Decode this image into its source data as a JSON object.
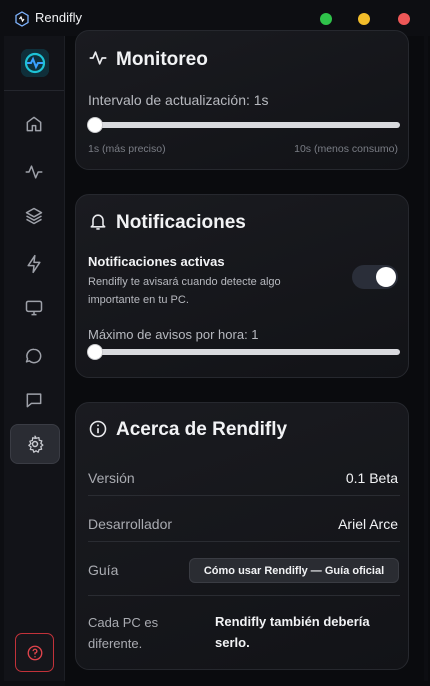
{
  "window": {
    "title": "Rendifly",
    "controls": [
      "green-dot",
      "yellow-dot",
      "red-dot"
    ],
    "colors": {
      "green": "#2fc24a",
      "yellow": "#f2bd2a",
      "red": "#ee5757"
    }
  },
  "sidebar": {
    "items": [
      {
        "name": "home",
        "icon": "home-icon"
      },
      {
        "name": "activity",
        "icon": "activity-icon"
      },
      {
        "name": "layers",
        "icon": "layers-icon"
      },
      {
        "name": "boost",
        "icon": "bolt-icon"
      },
      {
        "name": "monitor",
        "icon": "monitor-icon"
      },
      {
        "name": "chat",
        "icon": "chat-bubble-icon"
      },
      {
        "name": "messages",
        "icon": "message-square-icon"
      },
      {
        "name": "settings",
        "icon": "gear-icon",
        "active": true
      }
    ],
    "help_icon": "help-circle-icon"
  },
  "monitoring": {
    "title": "Monitoreo",
    "icon": "activity-icon",
    "interval_label": "Intervalo de actualización: 1s",
    "slider_value": 0,
    "min_label": "1s (más preciso)",
    "max_label": "10s (menos consumo)"
  },
  "notifications": {
    "title": "Notificaciones",
    "icon": "bell-icon",
    "active_label": "Notificaciones activas",
    "description": "Rendifly te avisará cuando detecte algo importante en tu PC.",
    "toggle_on": true,
    "max_label": "Máximo de avisos por hora: 1",
    "slider_value": 0
  },
  "about": {
    "title": "Acerca de Rendifly",
    "icon": "info-icon",
    "version_label": "Versión",
    "version_value": "0.1 Beta",
    "developer_label": "Desarrollador",
    "developer_value": "Ariel Arce",
    "guide_label": "Guía",
    "guide_button": "Cómo usar Rendifly — Guía oficial",
    "pc_label": "Cada PC es diferente.",
    "pc_value": "Rendifly también debería serlo."
  }
}
